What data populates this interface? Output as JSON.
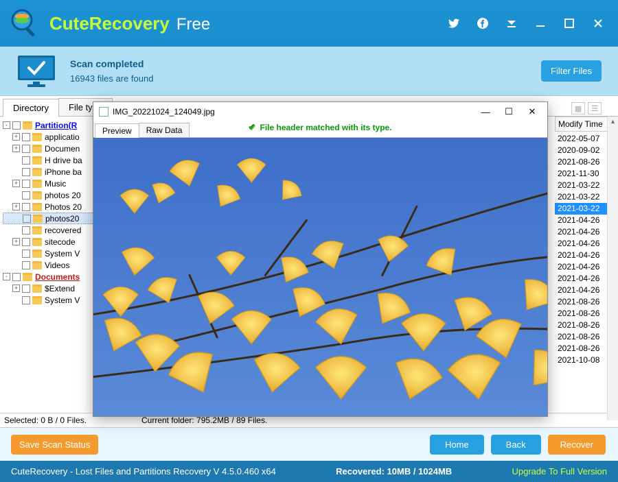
{
  "app": {
    "brand": "CuteRecovery",
    "edition": "Free"
  },
  "titlebar_icons": [
    "twitter",
    "facebook",
    "menu",
    "minimize",
    "maximize",
    "close"
  ],
  "status": {
    "heading": "Scan completed",
    "detail": "16943 files are found",
    "filter_btn": "Filter Files"
  },
  "tabs": {
    "directory": "Directory",
    "file_type": "File type"
  },
  "tree": {
    "partition_label": "Partition(R",
    "items": [
      {
        "exp": "+",
        "name": "applicatio",
        "indent": 1
      },
      {
        "exp": "+",
        "name": "Documen",
        "indent": 1
      },
      {
        "exp": "",
        "name": "H drive ba",
        "indent": 1
      },
      {
        "exp": "",
        "name": "iPhone ba",
        "indent": 1
      },
      {
        "exp": "+",
        "name": "Music",
        "indent": 1
      },
      {
        "exp": "",
        "name": "photos 20",
        "indent": 1
      },
      {
        "exp": "+",
        "name": "Photos 20",
        "indent": 1
      },
      {
        "exp": "",
        "name": "photos20",
        "indent": 1,
        "selected": true
      },
      {
        "exp": "",
        "name": "recovered",
        "indent": 1
      },
      {
        "exp": "+",
        "name": "sitecode",
        "indent": 1
      },
      {
        "exp": "",
        "name": "System V",
        "indent": 1
      },
      {
        "exp": "",
        "name": "Videos",
        "indent": 1
      }
    ],
    "documents_label": "Documents",
    "doc_items": [
      {
        "exp": "+",
        "name": "$Extend",
        "indent": 1
      },
      {
        "exp": "",
        "name": "System V",
        "indent": 1
      }
    ]
  },
  "list": {
    "col_header": "Modify Time",
    "dates": [
      "2022-05-07",
      "2020-09-02",
      "2021-08-26",
      "2021-11-30",
      "2021-03-22",
      "2021-03-22",
      "2021-03-22",
      "2021-04-26",
      "2021-04-26",
      "2021-04-26",
      "2021-04-26",
      "2021-04-26",
      "2021-04-26",
      "2021-04-26",
      "2021-08-26",
      "2021-08-26",
      "2021-08-26",
      "2021-08-26",
      "2021-08-26",
      "2021-10-08"
    ],
    "highlight_index": 6
  },
  "stats": {
    "selected": "Selected: 0 B / 0 Files.",
    "current": "Current folder: 795.2MB / 89 Files."
  },
  "actions": {
    "save_status": "Save Scan Status",
    "home": "Home",
    "back": "Back",
    "recover": "Recover"
  },
  "footer": {
    "title": "CuteRecovery - Lost Files and Partitions Recovery  V 4.5.0.460 x64",
    "recovered": "Recovered: 10MB / 1024MB",
    "upgrade": "Upgrade To Full Version"
  },
  "preview": {
    "filename": "IMG_20221024_124049.jpg",
    "tab_preview": "Preview",
    "tab_raw": "Raw Data",
    "message": "File header matched with its type."
  }
}
